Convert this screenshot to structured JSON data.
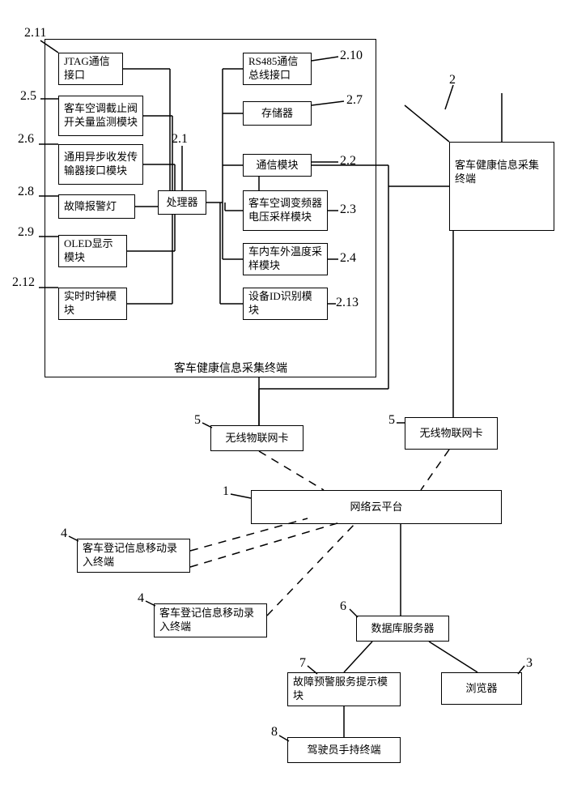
{
  "outer_caption": "客车健康信息采集终端",
  "nodes": {
    "n2_11": "JTAG通信接口",
    "n2_5": "客车空调截止阀开关量监测模块",
    "n2_6": "通用异步收发传输器接口模块",
    "n2_8": "故障报警灯",
    "n2_9": "OLED显示模块",
    "n2_12": "实时时钟模块",
    "n2_1": "处理器",
    "n2_10": "RS485通信总线接口",
    "n2_7": "存储器",
    "n2_2": "通信模块",
    "n2_3": "客车空调变频器电压采样模块",
    "n2_4": "车内车外温度采样模块",
    "n2_13": "设备ID识别模块",
    "n2_right": "客车健康信息采集终端",
    "n5a": "无线物联网卡",
    "n5b": "无线物联网卡",
    "n1": "网络云平台",
    "n4a": "客车登记信息移动录入终端",
    "n4b": "客车登记信息移动录入终端",
    "n6": "数据库服务器",
    "n7": "故障预警服务提示模块",
    "n3": "浏览器",
    "n8": "驾驶员手持终端"
  },
  "labels": {
    "l2_11": "2.11",
    "l2_5": "2.5",
    "l2_6": "2.6",
    "l2_8": "2.8",
    "l2_9": "2.9",
    "l2_12": "2.12",
    "l2_1": "2.1",
    "l2_10": "2.10",
    "l2_7": "2.7",
    "l2_2": "2.2",
    "l2_3": "2.3",
    "l2_4": "2.4",
    "l2_13": "2.13",
    "l2": "2",
    "l5a": "5",
    "l5b": "5",
    "l1": "1",
    "l4a": "4",
    "l4b": "4",
    "l6": "6",
    "l7": "7",
    "l3": "3",
    "l8": "8"
  }
}
